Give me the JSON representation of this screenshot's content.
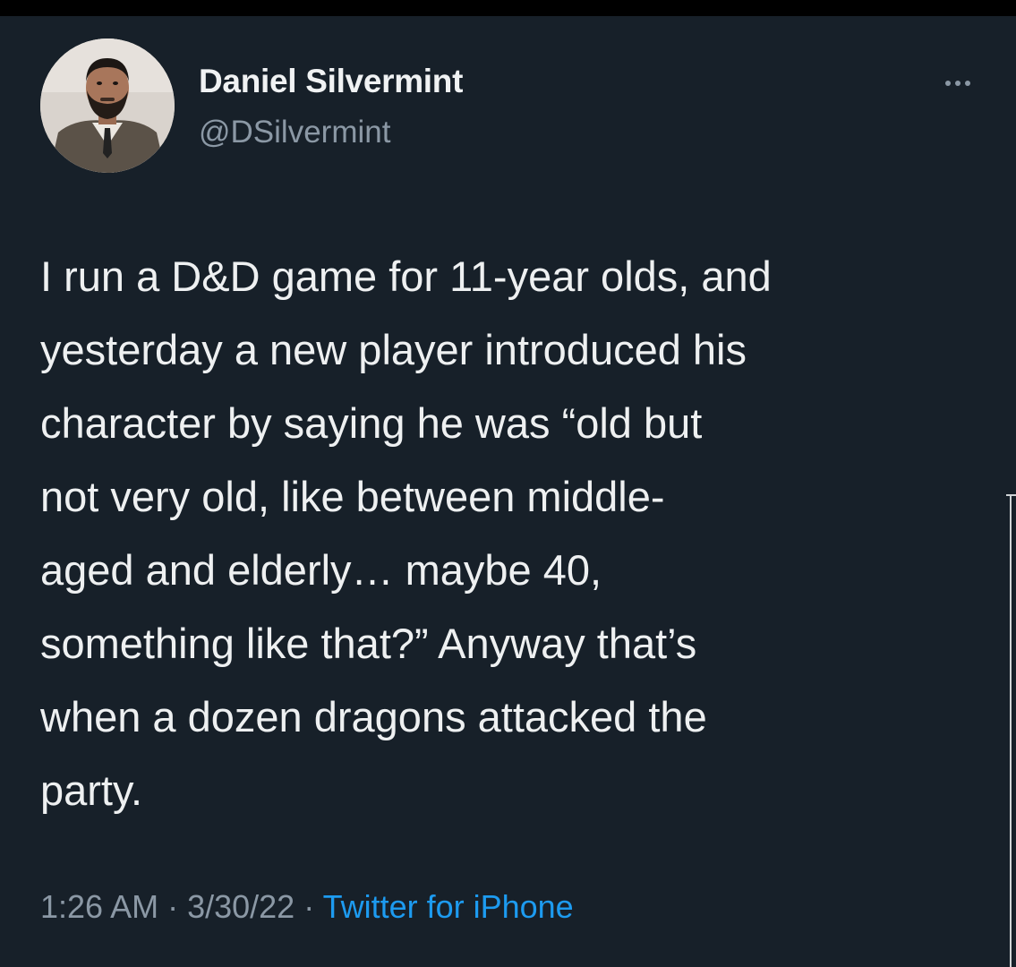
{
  "author": {
    "display_name": "Daniel Silvermint",
    "handle": "@DSilvermint",
    "avatar_icon": "profile-photo"
  },
  "more_icon": "ellipsis-icon",
  "tweet": {
    "text": "I run a D&D game for 11-year olds, and\nyesterday a new player introduced his\ncharacter by saying he was “old but\nnot very old, like between middle-\naged and elderly… maybe 40,\nsomething like that?” Anyway that’s\nwhen a dozen dragons attacked the\nparty."
  },
  "meta": {
    "time": "1:26 AM",
    "separator": " · ",
    "date": "3/30/22",
    "source": "Twitter for iPhone"
  },
  "colors": {
    "background": "#172029",
    "text": "#eef0f1",
    "secondary_text": "#8b98a5",
    "link": "#1d9bf0"
  }
}
